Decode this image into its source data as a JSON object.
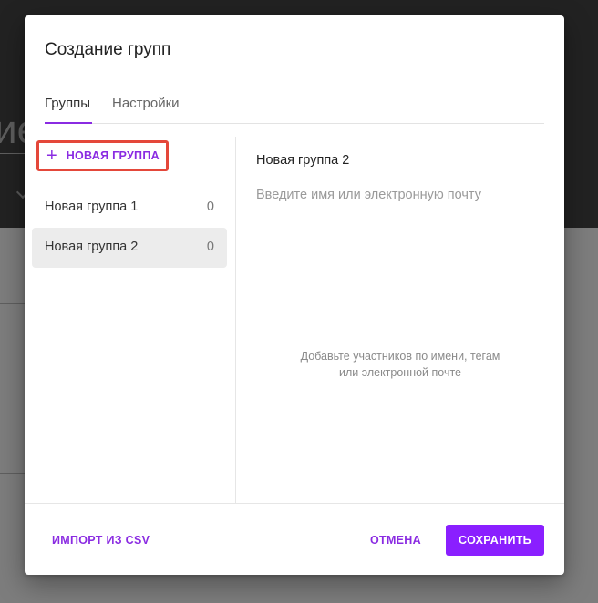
{
  "dialog": {
    "title": "Создание групп",
    "tabs": [
      {
        "label": "Группы",
        "active": true
      },
      {
        "label": "Настройки",
        "active": false
      }
    ]
  },
  "groups_panel": {
    "new_group_label": "НОВАЯ ГРУППА",
    "items": [
      {
        "name": "Новая группа 1",
        "count": "0"
      },
      {
        "name": "Новая группа 2",
        "count": "0",
        "selected": true
      }
    ]
  },
  "detail_panel": {
    "selected_group_title": "Новая группа 2",
    "member_input_placeholder": "Введите имя или электронную почту",
    "empty_hint_line1": "Добавьте участников по имени, тегам",
    "empty_hint_line2": "или электронной почте"
  },
  "footer": {
    "import_label": "ИМПОРТ ИЗ CSV",
    "cancel_label": "ОТМЕНА",
    "save_label": "СОХРАНИТЬ"
  },
  "background_app": {
    "partial_heading": "ие"
  },
  "colors": {
    "accent": "#8a2be2",
    "save_button": "#8a1fff",
    "highlight_border": "#e4473a"
  }
}
